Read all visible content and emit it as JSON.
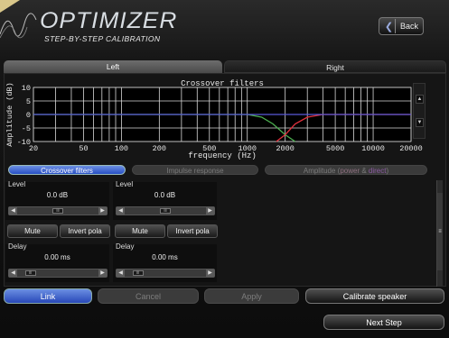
{
  "header": {
    "title": "OPTIMIZER",
    "subtitle": "STEP-BY-STEP CALIBRATION",
    "back_label": "Back",
    "back_icon": "arrow-left-icon"
  },
  "tabs": [
    {
      "label": "Left",
      "active": true
    },
    {
      "label": "Right",
      "active": false
    }
  ],
  "chart_data": {
    "type": "line",
    "title": "Crossover filters",
    "xlabel": "frequency (Hz)",
    "ylabel": "Amplitude (dB)",
    "x_scale": "log",
    "xlim": [
      20,
      20000
    ],
    "ylim": [
      -10,
      10
    ],
    "x_ticks": [
      "20",
      "50",
      "100",
      "200",
      "500",
      "1000",
      "2000",
      "5000",
      "10000",
      "20000"
    ],
    "y_ticks": [
      "10",
      "5",
      "0",
      "-5",
      "-10"
    ],
    "grid": true,
    "series": [
      {
        "color": "#4caf50",
        "x": [
          20,
          500,
          1000,
          1300,
          1600,
          2000,
          2400
        ],
        "y": [
          0,
          0,
          0,
          -1,
          -3.5,
          -7.5,
          -10
        ]
      },
      {
        "color": "#e0303c",
        "x": [
          1700,
          2000,
          2400,
          3000,
          4000,
          20000
        ],
        "y": [
          -10,
          -7.5,
          -3.5,
          -1,
          0,
          0
        ]
      },
      {
        "color": "#5a5ad8",
        "x": [
          20,
          20000
        ],
        "y": [
          0,
          0
        ]
      }
    ]
  },
  "scroll": {
    "up": "▲",
    "down": "▼",
    "grip": "≡"
  },
  "views": {
    "crossover": "Crossover filters",
    "impulse": "Impulse response",
    "amplitude_prefix": "Amplitude (",
    "amplitude_power": "power",
    "amplitude_amp": " & ",
    "amplitude_direct": "direct",
    "amplitude_suffix": ")"
  },
  "controls": {
    "level_label": "Level",
    "delay_label": "Delay",
    "left_group": {
      "level_value": "0.0 dB",
      "delay_value": "0.00 ms",
      "level_fraction": 0.5,
      "delay_fraction": 0.1
    },
    "right_group": {
      "level_value": "0.0 dB",
      "delay_value": "0.00 ms",
      "level_fraction": 0.5,
      "delay_fraction": 0.1
    },
    "mute_label": "Mute",
    "invert_label": "Invert pola",
    "arrow_left": "◀",
    "arrow_right": "▶",
    "thumb_grip": "iii"
  },
  "footer": {
    "link": "Link",
    "cancel": "Cancel",
    "apply": "Apply",
    "calibrate": "Calibrate speaker",
    "next": "Next Step"
  }
}
